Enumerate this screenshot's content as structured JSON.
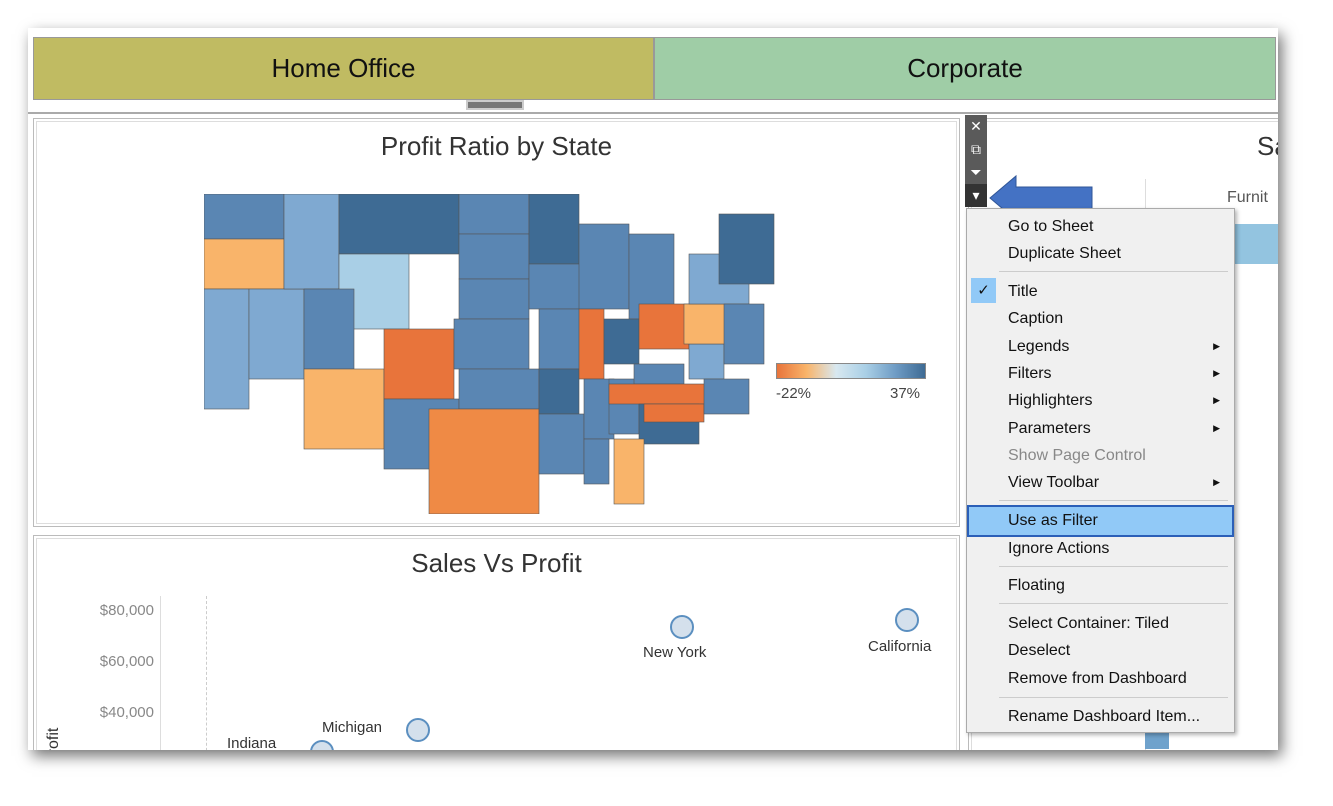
{
  "segments": {
    "home_office": "Home Office",
    "corporate": "Corporate",
    "home_office_color": "#c0bb62",
    "corporate_color": "#9fcda6"
  },
  "map_panel": {
    "title": "Profit Ratio by State",
    "legend_min": "-22%",
    "legend_max": "37%",
    "colors": {
      "negative": "#e8743b",
      "neutral": "#a9cfe6",
      "positive": "#3e6b94"
    }
  },
  "scatter_panel": {
    "title": "Sales Vs Profit",
    "y_axis_label": "Profit",
    "y_ticks": [
      "$80,000",
      "$60,000",
      "$40,000"
    ],
    "points": [
      {
        "label": "New York"
      },
      {
        "label": "California"
      },
      {
        "label": "Michigan"
      },
      {
        "label": "Indiana"
      }
    ]
  },
  "right_panel": {
    "title_partial": "Sa",
    "column_partial": "Furnit"
  },
  "toolbar": {
    "icons": [
      "close-icon",
      "popout-icon",
      "filter-icon",
      "dropdown-icon"
    ]
  },
  "menu": {
    "items": [
      "Go to Sheet",
      "Duplicate Sheet",
      "Title",
      "Caption",
      "Legends",
      "Filters",
      "Highlighters",
      "Parameters",
      "Show Page Control",
      "View Toolbar",
      "Use as Filter",
      "Ignore Actions",
      "Floating",
      "Select Container: Tiled",
      "Deselect",
      "Remove from Dashboard",
      "Rename Dashboard Item..."
    ],
    "checked": "Title",
    "highlighted": "Use as Filter",
    "disabled": "Show Page Control"
  }
}
